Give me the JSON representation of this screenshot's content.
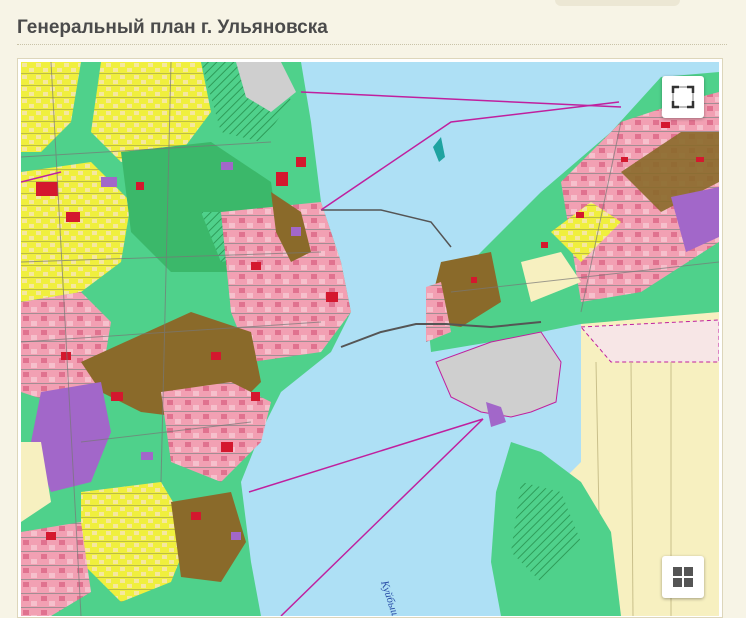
{
  "page": {
    "title": "Генеральный план г. Ульяновска"
  },
  "map": {
    "water_label": "Куйбышевское",
    "controls": {
      "fullscreen_icon": "fullscreen-icon",
      "layers_icon": "grid-icon"
    },
    "colors": {
      "water": "#aee0f5",
      "green": "#4fd18b",
      "forest": "#3bb86a",
      "residential": "#f2a0b3",
      "low_rise": "#f0ef3e",
      "industrial": "#8a6a2a",
      "special": "#a267c9",
      "public": "#d4182e",
      "agricultural": "#f7f0c0",
      "wasteland": "#cfcfcf",
      "boundary": "#c0209e"
    }
  }
}
